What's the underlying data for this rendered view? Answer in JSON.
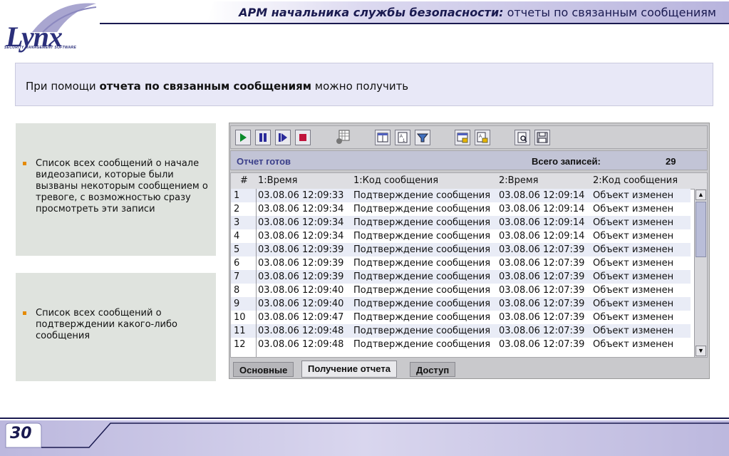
{
  "header": {
    "title_bold": "АРМ начальника службы безопасности:",
    "title_rest": " отчеты по связанным сообщениям"
  },
  "logo": {
    "name": "Lynx",
    "subtitle": "SECURITY MANAGEMENT SOFTWARE"
  },
  "intro": {
    "prefix": "При помощи ",
    "bold": "отчета по связанным сообщениям",
    "suffix": " можно получить"
  },
  "bullets": [
    "Список всех сообщений о начале видеозаписи, которые были вызваны некоторым сообщением о тревоге, с возможностью сразу просмотреть эти записи",
    "Список всех сообщений о подтверждении какого-либо сообщения"
  ],
  "toolbar": {
    "icons": [
      "play-icon",
      "pause-icon",
      "step-icon",
      "stop-icon",
      "columns-settings-icon",
      "window-icon",
      "sort-icon",
      "filter-icon",
      "lock-window-icon",
      "lock-sort-icon",
      "preview-icon",
      "save-icon"
    ]
  },
  "status": {
    "text": "Отчет готов",
    "total_label": "Всего записей:",
    "total_value": "29"
  },
  "table": {
    "headers": [
      "#",
      "1:Время",
      "1:Код сообщения",
      "2:Время",
      "2:Код сообщения"
    ],
    "rows": [
      [
        "1",
        "03.08.06 12:09:33",
        "Подтверждение сообщения",
        "03.08.06 12:09:14",
        "Объект изменен"
      ],
      [
        "2",
        "03.08.06 12:09:34",
        "Подтверждение сообщения",
        "03.08.06 12:09:14",
        "Объект изменен"
      ],
      [
        "3",
        "03.08.06 12:09:34",
        "Подтверждение сообщения",
        "03.08.06 12:09:14",
        "Объект изменен"
      ],
      [
        "4",
        "03.08.06 12:09:34",
        "Подтверждение сообщения",
        "03.08.06 12:09:14",
        "Объект изменен"
      ],
      [
        "5",
        "03.08.06 12:09:39",
        "Подтверждение сообщения",
        "03.08.06 12:07:39",
        "Объект изменен"
      ],
      [
        "6",
        "03.08.06 12:09:39",
        "Подтверждение сообщения",
        "03.08.06 12:07:39",
        "Объект изменен"
      ],
      [
        "7",
        "03.08.06 12:09:39",
        "Подтверждение сообщения",
        "03.08.06 12:07:39",
        "Объект изменен"
      ],
      [
        "8",
        "03.08.06 12:09:40",
        "Подтверждение сообщения",
        "03.08.06 12:07:39",
        "Объект изменен"
      ],
      [
        "9",
        "03.08.06 12:09:40",
        "Подтверждение сообщения",
        "03.08.06 12:07:39",
        "Объект изменен"
      ],
      [
        "10",
        "03.08.06 12:09:47",
        "Подтверждение сообщения",
        "03.08.06 12:07:39",
        "Объект изменен"
      ],
      [
        "11",
        "03.08.06 12:09:48",
        "Подтверждение сообщения",
        "03.08.06 12:07:39",
        "Объект изменен"
      ],
      [
        "12",
        "03.08.06 12:09:48",
        "Подтверждение сообщения",
        "03.08.06 12:07:39",
        "Объект изменен"
      ]
    ]
  },
  "tabs": [
    "Основные",
    "Получение отчета",
    "Доступ"
  ],
  "active_tab": "Получение отчета",
  "footer": {
    "page_number": "30"
  },
  "colors": {
    "accent": "#2b2f7a",
    "bullet": "#e58a00",
    "header_band": "#b9b5dc"
  }
}
